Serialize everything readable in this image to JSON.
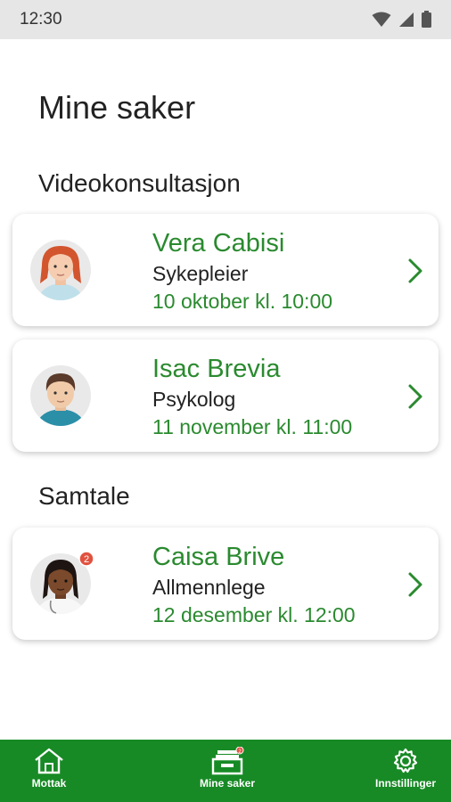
{
  "status_bar": {
    "time": "12:30"
  },
  "page_title": "Mine saker",
  "sections": [
    {
      "title": "Videokonsultasjon",
      "items": [
        {
          "name": "Vera Cabisi",
          "role": "Sykepleier",
          "date": "10 oktober kl. 10:00"
        },
        {
          "name": "Isac Brevia",
          "role": "Psykolog",
          "date": "11 november kl. 11:00"
        }
      ]
    },
    {
      "title": "Samtale",
      "items": [
        {
          "name": "Caisa Brive",
          "role": "Allmennlege",
          "date": "12 desember kl. 12:00",
          "badge": "2"
        }
      ]
    }
  ],
  "bottom_nav": {
    "items": [
      {
        "label": "Mottak",
        "icon": "home-icon"
      },
      {
        "label": "Mine saker",
        "icon": "cases-icon",
        "badge": "2"
      },
      {
        "label": "Innstillinger",
        "icon": "gear-icon"
      }
    ]
  },
  "colors": {
    "accent_green": "#2a8a2f",
    "nav_green": "#178a25",
    "badge_red": "#e0523f"
  }
}
